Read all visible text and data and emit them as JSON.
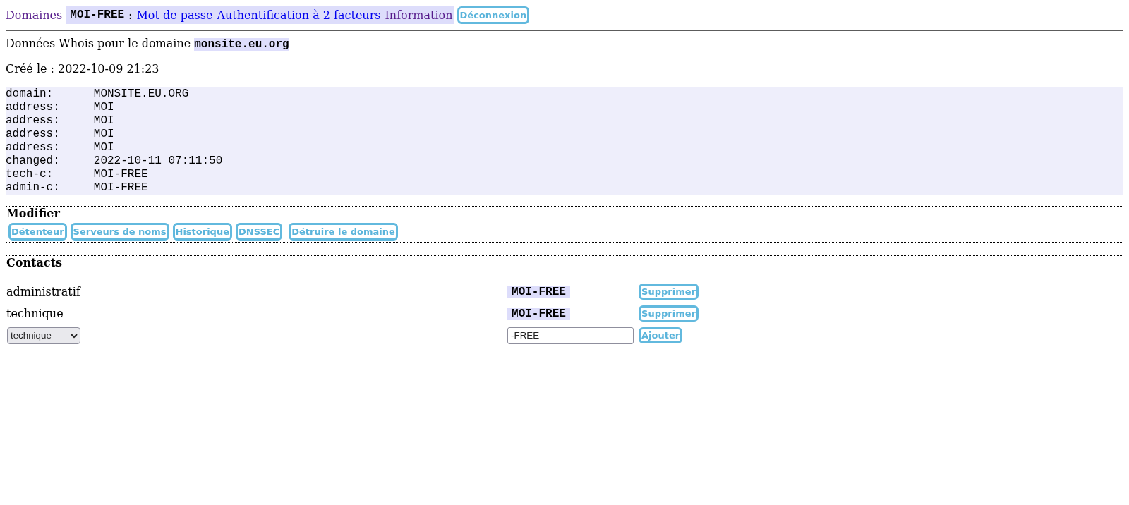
{
  "nav": {
    "home_link": {
      "label": "Domaines",
      "visited": true
    },
    "account": {
      "handle": "MOI-FREE",
      "separator": ":",
      "links": [
        {
          "label": "Mot de passe",
          "visited": false
        },
        {
          "label": "Authentification à 2 facteurs",
          "visited": false
        },
        {
          "label": "Information",
          "visited": true
        }
      ]
    },
    "logout_button": "Déconnexion"
  },
  "heading": "Données Whois pour le domaine **monsite.eu.org**",
  "created": "Créé le : 2022-10-09 21:23",
  "whois": [
    {
      "key": "domain:",
      "value": "MONSITE.EU.ORG"
    },
    {
      "key": "address:",
      "value": "MOI"
    },
    {
      "key": "address:",
      "value": "MOI"
    },
    {
      "key": "address:",
      "value": "MOI"
    },
    {
      "key": "address:",
      "value": "MOI"
    },
    {
      "key": "changed:",
      "value": "2022-10-11 07:11:50"
    },
    {
      "key": "tech-c:",
      "value": "MOI-FREE"
    },
    {
      "key": "admin-c:",
      "value": "MOI-FREE"
    }
  ],
  "modify": {
    "title": "Modifier",
    "buttons": [
      "Détenteur",
      "Serveurs de noms",
      "Historique",
      "DNSSEC"
    ],
    "destroy_button": "Détruire le domaine"
  },
  "contacts": {
    "title": "Contacts",
    "rows": [
      {
        "role": "administratif",
        "handle": "MOI-FREE",
        "button": "Supprimer"
      },
      {
        "role": "technique",
        "handle": "MOI-FREE",
        "button": "Supprimer"
      }
    ],
    "add": {
      "type": "technique",
      "handle": "-FREE",
      "button": "Ajouter"
    }
  }
}
